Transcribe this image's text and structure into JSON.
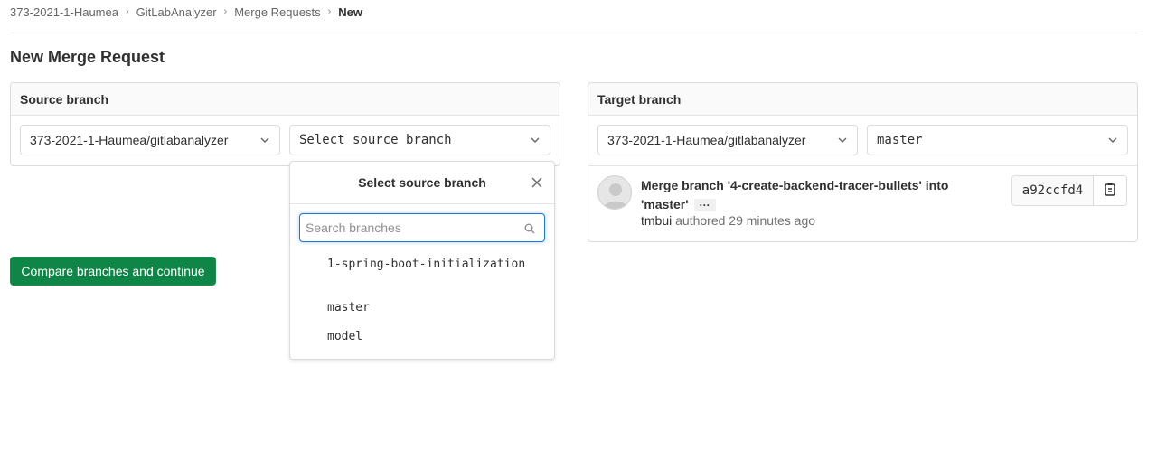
{
  "breadcrumb": [
    {
      "label": "373-2021-1-Haumea"
    },
    {
      "label": "GitLabAnalyzer"
    },
    {
      "label": "Merge Requests"
    },
    {
      "label": "New"
    }
  ],
  "page_title": "New Merge Request",
  "source": {
    "header": "Source branch",
    "project_value": "373-2021-1-Haumea/gitlabanalyzer",
    "branch_value": "Select source branch"
  },
  "target": {
    "header": "Target branch",
    "project_value": "373-2021-1-Haumea/gitlabanalyzer",
    "branch_value": "master"
  },
  "dropdown": {
    "title": "Select source branch",
    "search_placeholder": "Search branches",
    "branches": [
      "1-spring-boot-initialization",
      "master",
      "model"
    ]
  },
  "compare_button": "Compare branches and continue",
  "commit": {
    "title": "Merge branch '4-create-backend-tracer-bullets' into 'master'",
    "ellipsis": "···",
    "author": "tmbui",
    "meta": "authored 29 minutes ago",
    "sha": "a92ccfd4"
  },
  "icons": {
    "chevron": "chevron-down-icon",
    "close": "close-icon",
    "search": "search-icon",
    "copy": "clipboard-icon",
    "avatar": "avatar-placeholder"
  },
  "colors": {
    "primary_button": "#108548",
    "focus_border": "#1f78d1"
  }
}
